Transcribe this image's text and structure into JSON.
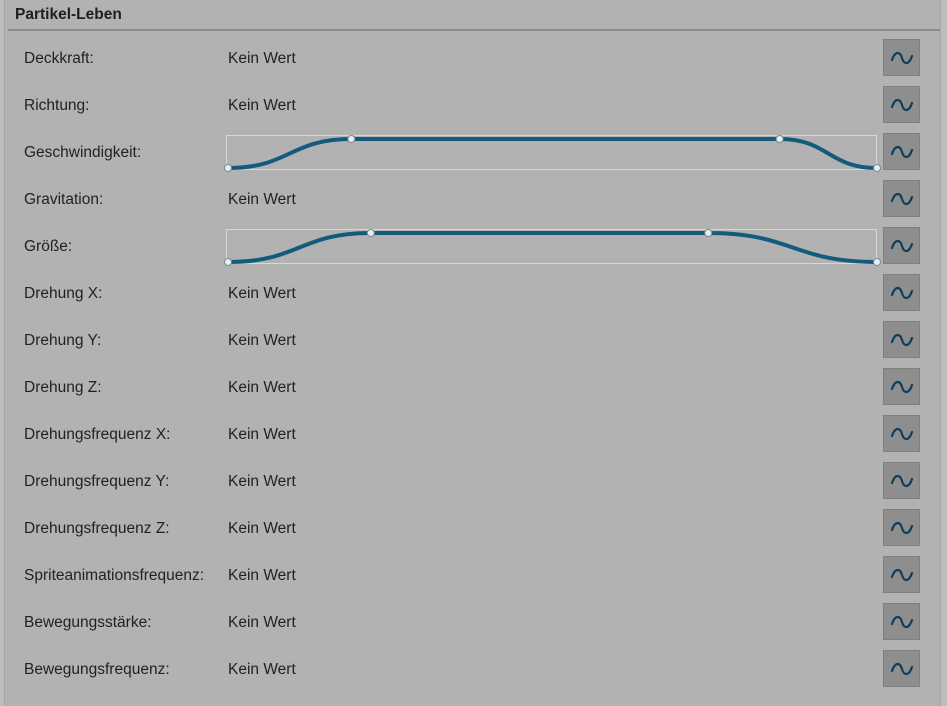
{
  "panel": {
    "title": "Partikel-Leben"
  },
  "colors": {
    "curve": "#145a7d",
    "handle": "#e6eef2",
    "button_bg": "#8e8e8e",
    "icon": "#0f3d5c"
  },
  "rows": [
    {
      "key": "deckkraft",
      "label": "Deckkraft:",
      "value": "Kein Wert",
      "icon": "tilde-curve-icon"
    },
    {
      "key": "richtung",
      "label": "Richtung:",
      "value": "Kein Wert",
      "icon": "tilde-curve-icon"
    },
    {
      "key": "geschwindigkeit",
      "label": "Geschwindigkeit:",
      "value": "",
      "icon": "tilde-curve-icon"
    },
    {
      "key": "gravitation",
      "label": "Gravitation:",
      "value": "Kein Wert",
      "icon": "tilde-curve-icon"
    },
    {
      "key": "groesse",
      "label": "Größe:",
      "value": "",
      "icon": "tilde-curve-icon"
    },
    {
      "key": "drehung-x",
      "label": "Drehung X:",
      "value": "Kein Wert",
      "icon": "tilde-curve-icon"
    },
    {
      "key": "drehung-y",
      "label": "Drehung Y:",
      "value": "Kein Wert",
      "icon": "tilde-curve-icon"
    },
    {
      "key": "drehung-z",
      "label": "Drehung Z:",
      "value": "Kein Wert",
      "icon": "tilde-curve-icon"
    },
    {
      "key": "drehungsfrequenz-x",
      "label": "Drehungsfrequenz X:",
      "value": "Kein Wert",
      "icon": "tilde-curve-icon"
    },
    {
      "key": "drehungsfrequenz-y",
      "label": "Drehungsfrequenz Y:",
      "value": "Kein Wert",
      "icon": "tilde-curve-icon"
    },
    {
      "key": "drehungsfrequenz-z",
      "label": "Drehungsfrequenz Z:",
      "value": "Kein Wert",
      "icon": "tilde-curve-icon"
    },
    {
      "key": "spriteanimationsfrequenz",
      "label": "Spriteanimationsfrequenz:",
      "value": "Kein Wert",
      "icon": "tilde-curve-icon"
    },
    {
      "key": "bewegungsstaerke",
      "label": "Bewegungsstärke:",
      "value": "Kein Wert",
      "icon": "tilde-curve-icon"
    },
    {
      "key": "bewegungsfrequenz",
      "label": "Bewegungsfrequenz:",
      "value": "Kein Wert",
      "icon": "tilde-curve-icon"
    }
  ],
  "curves": {
    "geschwindigkeit": {
      "keyframes": [
        {
          "t": 0.0,
          "v": 0.0
        },
        {
          "t": 0.19,
          "v": 1.0
        },
        {
          "t": 0.85,
          "v": 1.0
        },
        {
          "t": 1.0,
          "v": 0.0
        }
      ]
    },
    "groesse": {
      "keyframes": [
        {
          "t": 0.0,
          "v": 0.0
        },
        {
          "t": 0.22,
          "v": 1.0
        },
        {
          "t": 0.74,
          "v": 1.0
        },
        {
          "t": 1.0,
          "v": 0.0
        }
      ]
    }
  }
}
